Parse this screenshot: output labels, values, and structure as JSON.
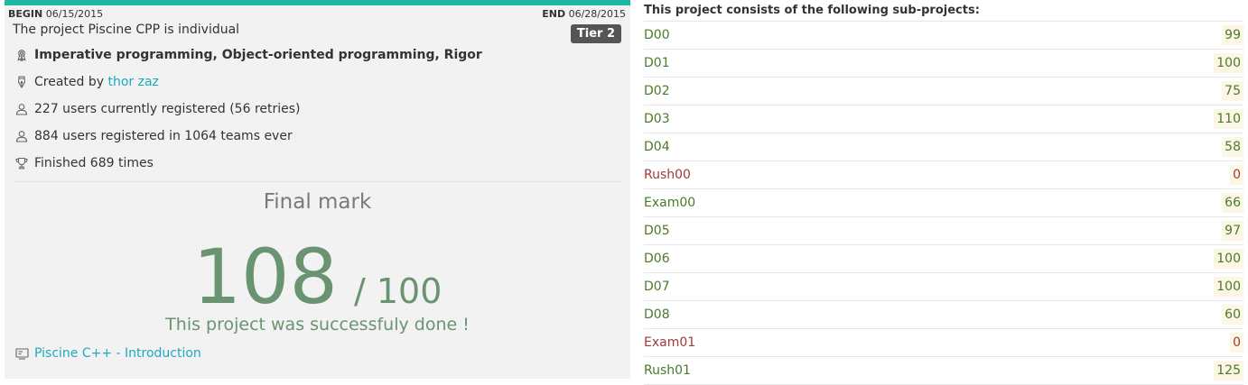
{
  "project": {
    "begin_label": "BEGIN",
    "begin_date": "06/15/2015",
    "end_label": "END",
    "end_date": "06/28/2015",
    "progress_fraction": 1.0,
    "description": "The project Piscine CPP is individual",
    "tier": "Tier 2",
    "skills": "Imperative programming, Object-oriented programming, Rigor",
    "created_by_label": "Created by",
    "author": "thor zaz",
    "registered_now": "227 users currently registered (56 retries)",
    "registered_ever": "884 users registered in 1064 teams ever",
    "finished": "Finished 689 times",
    "final_mark_title": "Final mark",
    "final_mark": "108",
    "max_mark": "/ 100",
    "status_message": "This project was successfuly done !",
    "parent_project": "Piscine C++ - Introduction"
  },
  "colors": {
    "accent": "#1fb8a6",
    "link": "#1fa9c1",
    "success": "#6a9471",
    "pass": "#4a7a2a",
    "fail": "#a03a3a"
  },
  "icons": {
    "skills": "skills-icon",
    "author": "pen-icon",
    "registered_now": "user-icon",
    "registered_ever": "user-icon",
    "finished": "trophy-icon",
    "parent": "presentation-icon"
  },
  "subprojects": {
    "heading": "This project consists of the following sub-projects:",
    "items": [
      {
        "name": "D00",
        "score": "99",
        "status": "pass"
      },
      {
        "name": "D01",
        "score": "100",
        "status": "pass"
      },
      {
        "name": "D02",
        "score": "75",
        "status": "pass"
      },
      {
        "name": "D03",
        "score": "110",
        "status": "pass"
      },
      {
        "name": "D04",
        "score": "58",
        "status": "pass"
      },
      {
        "name": "Rush00",
        "score": "0",
        "status": "fail"
      },
      {
        "name": "Exam00",
        "score": "66",
        "status": "pass"
      },
      {
        "name": "D05",
        "score": "97",
        "status": "pass"
      },
      {
        "name": "D06",
        "score": "100",
        "status": "pass"
      },
      {
        "name": "D07",
        "score": "100",
        "status": "pass"
      },
      {
        "name": "D08",
        "score": "60",
        "status": "pass"
      },
      {
        "name": "Exam01",
        "score": "0",
        "status": "fail"
      },
      {
        "name": "Rush01",
        "score": "125",
        "status": "pass"
      }
    ]
  }
}
